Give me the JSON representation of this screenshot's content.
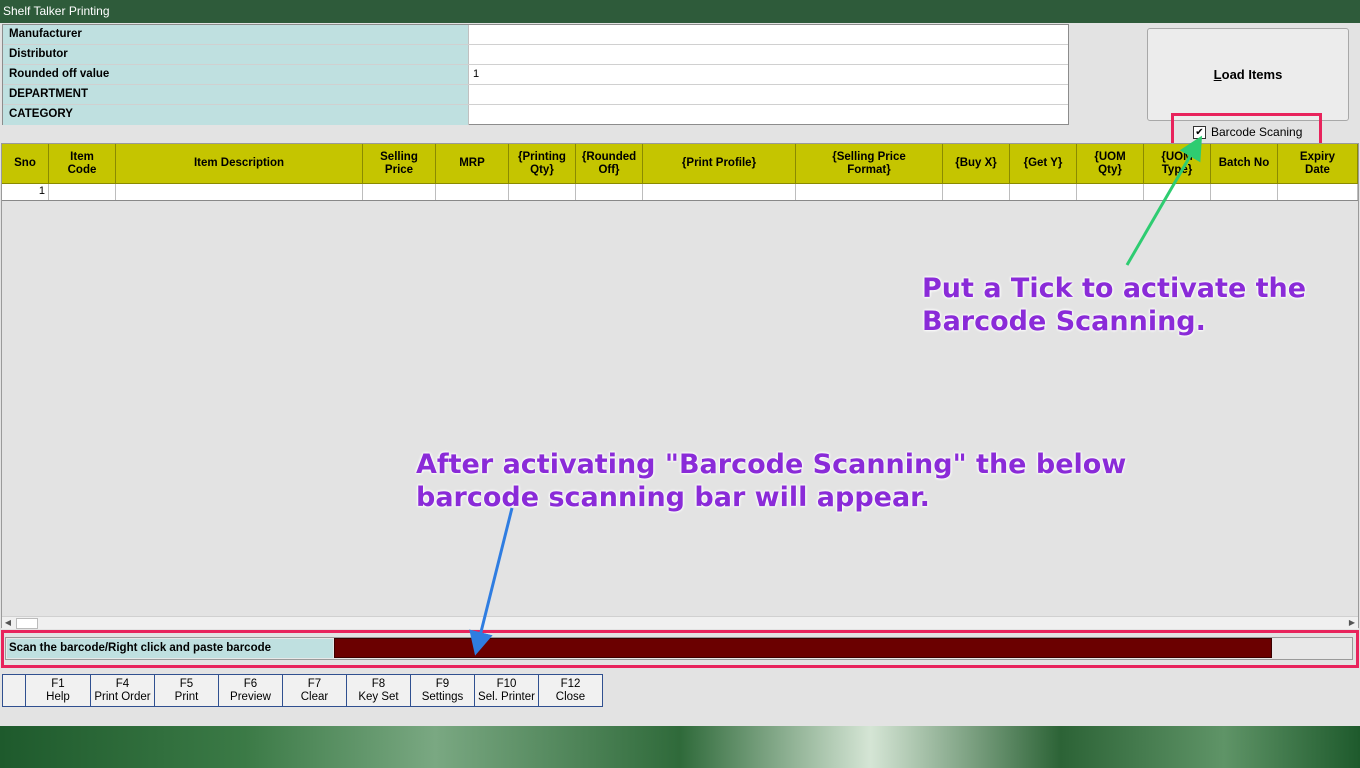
{
  "window": {
    "title": "Shelf Talker Printing"
  },
  "filters": [
    {
      "label": "Manufacturer",
      "value": ""
    },
    {
      "label": "Distributor",
      "value": ""
    },
    {
      "label": "Rounded off value",
      "value": "1"
    },
    {
      "label": "DEPARTMENT",
      "value": ""
    },
    {
      "label": "CATEGORY",
      "value": ""
    }
  ],
  "load_button": {
    "underlined": "L",
    "rest": "oad Items"
  },
  "barcode_checkbox": {
    "label": "Barcode Scaning",
    "checked": true
  },
  "grid": {
    "columns": [
      "Sno",
      "Item\nCode",
      "Item Description",
      "Selling\nPrice",
      "MRP",
      "{Printing\nQty}",
      "{Rounded\nOff}",
      "{Print Profile}",
      "{Selling Price\nFormat}",
      "{Buy X}",
      "{Get Y}",
      "{UOM\nQty}",
      "{UOM\nType}",
      "Batch No",
      "Expiry\nDate"
    ],
    "rows": [
      {
        "sno": "1"
      }
    ]
  },
  "scan_bar": {
    "label": "Scan the barcode/Right click and paste barcode",
    "value": ""
  },
  "function_keys": [
    {
      "key": "",
      "label": ""
    },
    {
      "key": "F1",
      "label": "Help"
    },
    {
      "key": "F4",
      "label": "Print Order"
    },
    {
      "key": "F5",
      "label": "Print"
    },
    {
      "key": "F6",
      "label": "Preview"
    },
    {
      "key": "F7",
      "label": "Clear"
    },
    {
      "key": "F8",
      "label": "Key Set"
    },
    {
      "key": "F9",
      "label": "Settings"
    },
    {
      "key": "F10",
      "label": "Sel. Printer"
    },
    {
      "key": "F12",
      "label": "Close"
    }
  ],
  "annotations": {
    "tick_note": "Put a Tick to activate the Barcode Scanning.",
    "scan_note": "After activating \"Barcode Scanning\" the below barcode scanning bar will appear."
  },
  "colors": {
    "header_yellow": "#c5c500",
    "label_teal": "#bfe0e0",
    "scan_input": "#6b0000",
    "highlight_red": "#e8235c",
    "annotation_purple": "#8a2bd8",
    "arrow_green": "#2ecc71",
    "arrow_blue": "#2f7de1"
  }
}
